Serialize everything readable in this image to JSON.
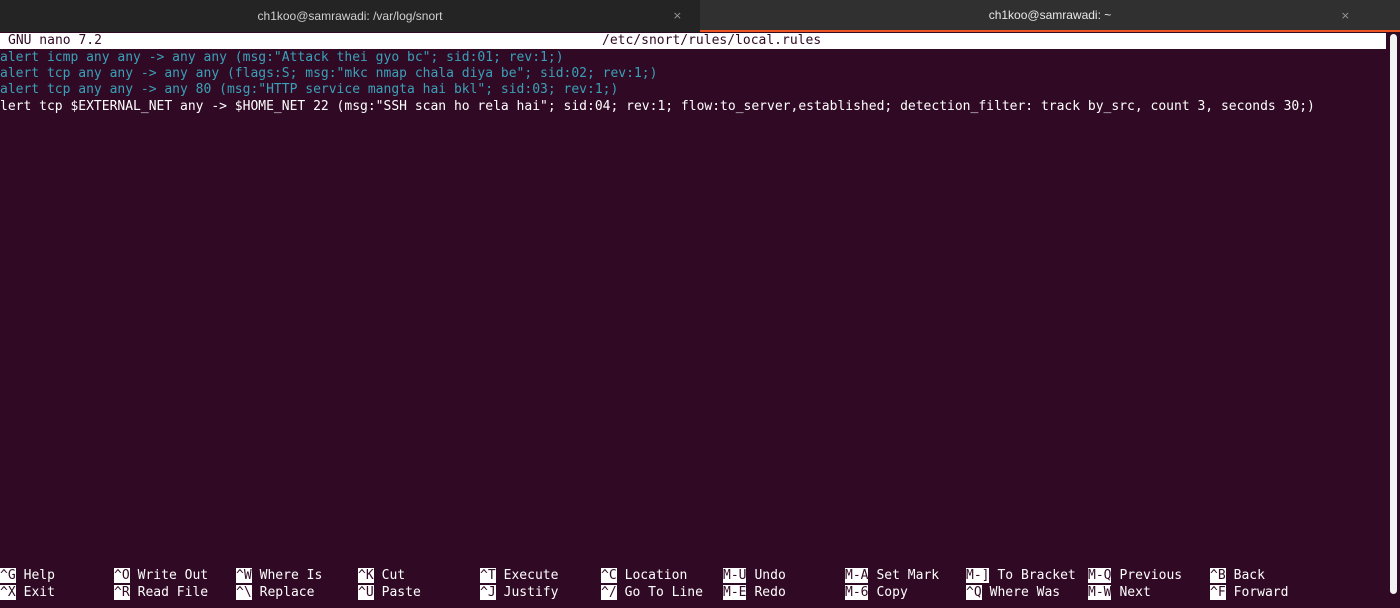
{
  "tabs": [
    {
      "title": "ch1koo@samrawadi: /var/log/snort",
      "close": "×"
    },
    {
      "title": "ch1koo@samrawadi: ~",
      "close": "×"
    }
  ],
  "nano": {
    "version": "GNU nano 7.2",
    "filename": "/etc/snort/rules/local.rules"
  },
  "lines": [
    "alert icmp any any -> any any (msg:\"Attack thei gyo bc\"; sid:01; rev:1;)",
    "alert tcp any any -> any any (flags:S; msg:\"mkc nmap chala diya be\"; sid:02; rev:1;)",
    "alert tcp any any -> any 80 (msg:\"HTTP service mangta hai bkl\"; sid:03; rev:1;)",
    "lert tcp $EXTERNAL_NET any -> $HOME_NET 22 (msg:\"SSH scan ho rela hai\"; sid:04; rev:1; flow:to_server,established; detection_filter: track by_src, count 3, seconds 30;)"
  ],
  "shortcuts_row1": [
    {
      "key": "^G",
      "label": "Help"
    },
    {
      "key": "^O",
      "label": "Write Out"
    },
    {
      "key": "^W",
      "label": "Where Is"
    },
    {
      "key": "^K",
      "label": "Cut"
    },
    {
      "key": "^T",
      "label": "Execute"
    },
    {
      "key": "^C",
      "label": "Location"
    },
    {
      "key": "M-U",
      "label": "Undo"
    },
    {
      "key": "M-A",
      "label": "Set Mark"
    },
    {
      "key": "M-]",
      "label": "To Bracket"
    },
    {
      "key": "M-Q",
      "label": "Previous"
    },
    {
      "key": "^B",
      "label": "Back"
    }
  ],
  "shortcuts_row2": [
    {
      "key": "^X",
      "label": "Exit"
    },
    {
      "key": "^R",
      "label": "Read File"
    },
    {
      "key": "^\\",
      "label": "Replace"
    },
    {
      "key": "^U",
      "label": "Paste"
    },
    {
      "key": "^J",
      "label": "Justify"
    },
    {
      "key": "^/",
      "label": "Go To Line"
    },
    {
      "key": "M-E",
      "label": "Redo"
    },
    {
      "key": "M-6",
      "label": "Copy"
    },
    {
      "key": "^Q",
      "label": "Where Was"
    },
    {
      "key": "M-W",
      "label": "Next"
    },
    {
      "key": "^F",
      "label": "Forward"
    }
  ]
}
